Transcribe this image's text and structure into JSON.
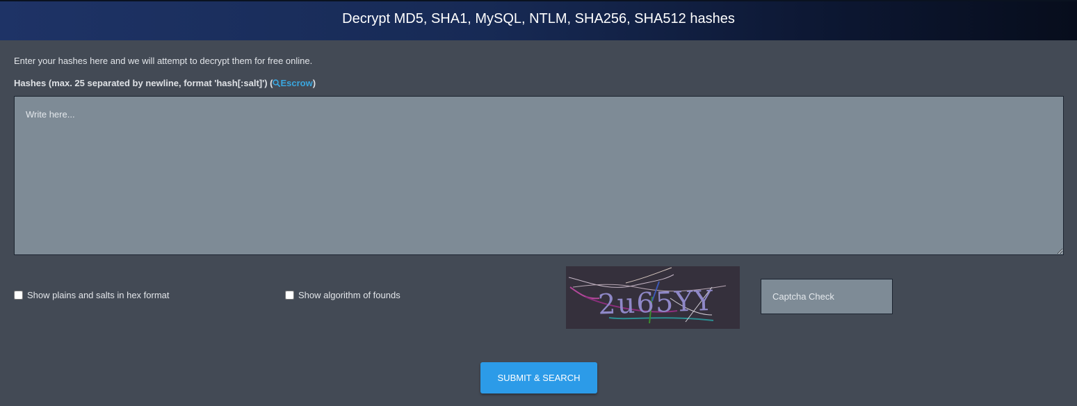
{
  "header": {
    "title": "Decrypt MD5, SHA1, MySQL, NTLM, SHA256, SHA512 hashes"
  },
  "form": {
    "intro": "Enter your hashes here and we will attempt to decrypt them for free online.",
    "hashes_label": "Hashes (max. 25 separated by newline, format 'hash[:salt]') (",
    "escrow_link": "Escrow",
    "hashes_label_close": ")",
    "hashes_placeholder": "Write here...",
    "hashes_value": "",
    "hex_checkbox_label": "Show plains and salts in hex format",
    "hex_checkbox_checked": false,
    "algo_checkbox_label": "Show algorithm of founds",
    "algo_checkbox_checked": false,
    "captcha_text": "2u65YY",
    "captcha_placeholder": "Captcha Check",
    "submit_label": "SUBMIT & SEARCH"
  },
  "icons": {
    "escrow_icon": "search-icon"
  },
  "colors": {
    "background": "#434a55",
    "input_background": "#7e8b96",
    "link": "#3aa7e0",
    "button": "#2c9be8"
  }
}
